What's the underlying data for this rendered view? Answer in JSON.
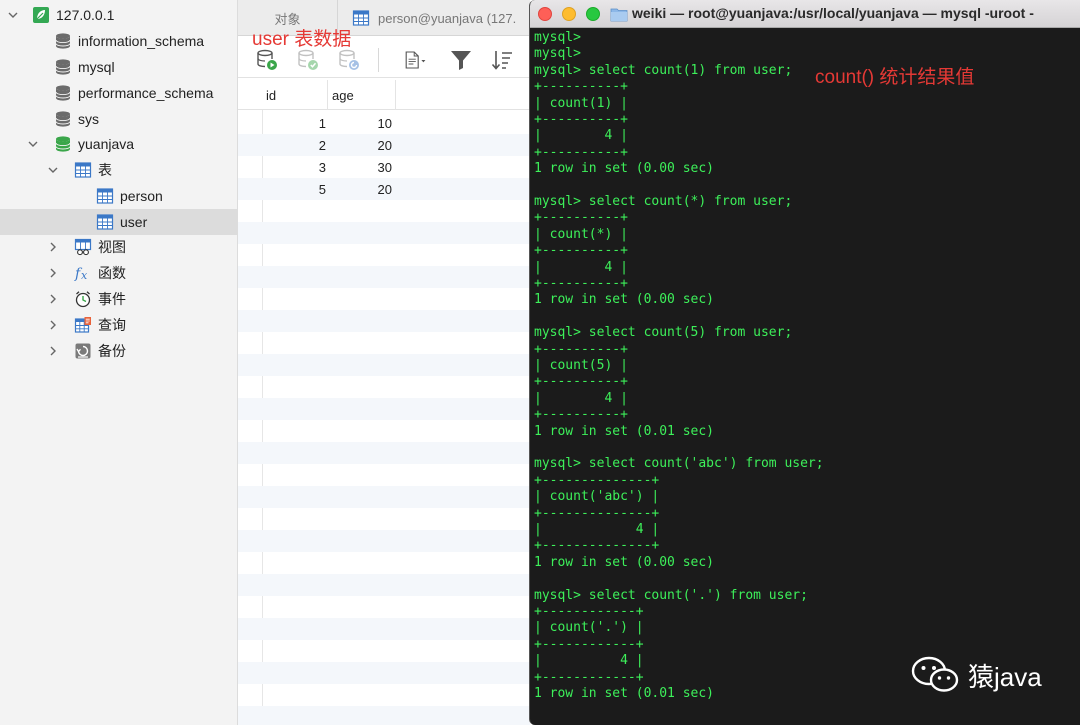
{
  "sidebar": {
    "connection": "127.0.0.1",
    "databases": [
      "information_schema",
      "mysql",
      "performance_schema",
      "sys"
    ],
    "active_db": "yuanjava",
    "tables_folder": "表",
    "tables": [
      "person",
      "user"
    ],
    "selected_table": "user",
    "groups": [
      "视图",
      "函数",
      "事件",
      "查询",
      "备份"
    ]
  },
  "tabs": {
    "objects": "对象",
    "person": "person@yuanjava (127."
  },
  "annotations": {
    "user_table": "user 表数据",
    "count_result": "count() 统计结果值"
  },
  "grid": {
    "columns": [
      "id",
      "age"
    ],
    "rows": [
      [
        "1",
        "10"
      ],
      [
        "2",
        "20"
      ],
      [
        "3",
        "30"
      ],
      [
        "5",
        "20"
      ]
    ]
  },
  "terminal": {
    "title": "weiki — root@yuanjava:/usr/local/yuanjava — mysql -uroot -",
    "lines": [
      "mysql>",
      "mysql>",
      "mysql> select count(1) from user;",
      "+----------+",
      "| count(1) |",
      "+----------+",
      "|        4 |",
      "+----------+",
      "1 row in set (0.00 sec)",
      "",
      "mysql> select count(*) from user;",
      "+----------+",
      "| count(*) |",
      "+----------+",
      "|        4 |",
      "+----------+",
      "1 row in set (0.00 sec)",
      "",
      "mysql> select count(5) from user;",
      "+----------+",
      "| count(5) |",
      "+----------+",
      "|        4 |",
      "+----------+",
      "1 row in set (0.01 sec)",
      "",
      "mysql> select count('abc') from user;",
      "+--------------+",
      "| count('abc') |",
      "+--------------+",
      "|            4 |",
      "+--------------+",
      "1 row in set (0.00 sec)",
      "",
      "mysql> select count('.') from user;",
      "+------------+",
      "| count('.') |",
      "+------------+",
      "|          4 |",
      "+------------+",
      "1 row in set (0.01 sec)"
    ]
  },
  "watermark": "猿java",
  "colors": {
    "terminal_text": "#3df05a",
    "annotation": "#e53935",
    "db_icon_gray": "#6b6b6b",
    "db_icon_green": "#3aa64a",
    "connection_icon_green": "#33a853",
    "table_icon_blue": "#3b78c7"
  }
}
